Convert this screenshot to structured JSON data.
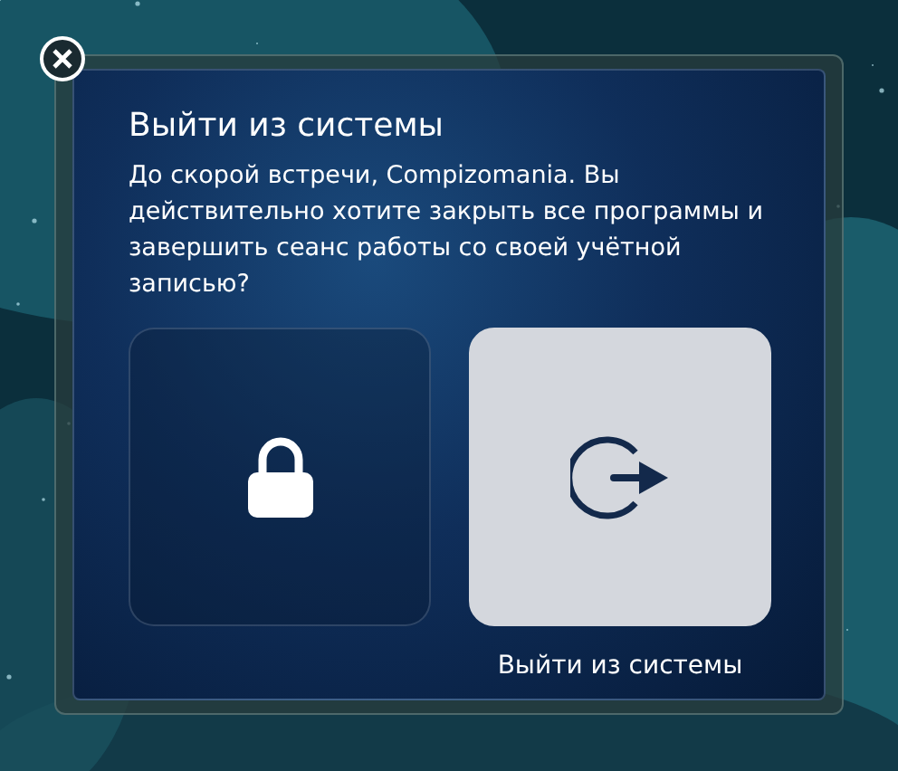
{
  "dialog": {
    "title": "Выйти из системы",
    "message": "До скорой встречи, Compizomania. Вы действительно хотите закрыть все программы и завершить сеанс работы со своей учётной записью?",
    "options": [
      {
        "kind": "lock",
        "selected": false
      },
      {
        "kind": "logout",
        "label": "Выйти из системы",
        "selected": true
      }
    ]
  }
}
